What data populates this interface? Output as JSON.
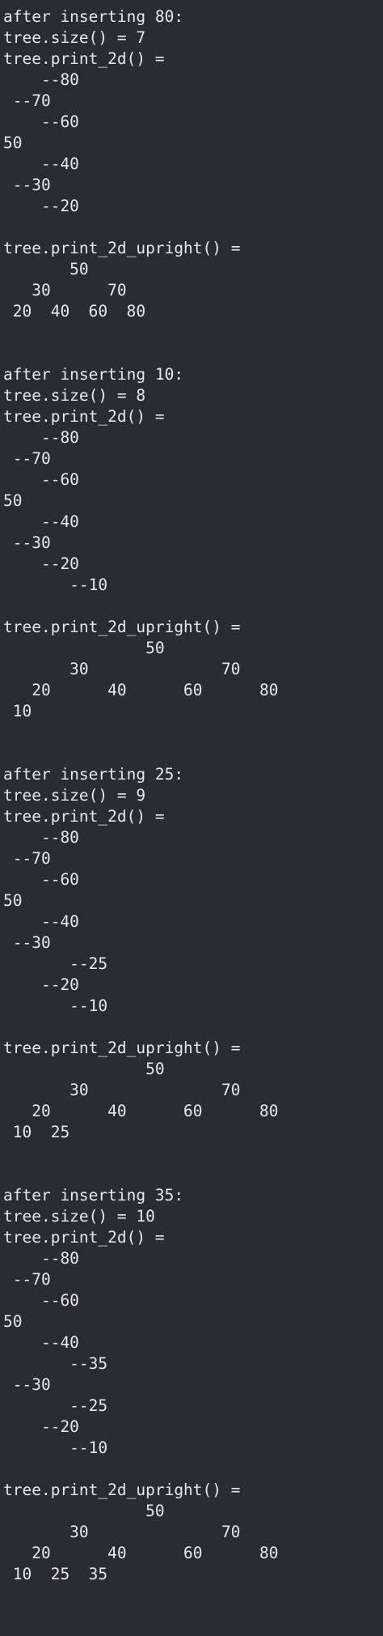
{
  "terminal": {
    "lines": [
      "after inserting 80:",
      "tree.size() = 7",
      "tree.print_2d() =",
      "    --80",
      " --70",
      "    --60",
      "50",
      "    --40",
      " --30",
      "    --20",
      "",
      "tree.print_2d_upright() =",
      "       50",
      "   30      70",
      " 20  40  60  80",
      "",
      "",
      "after inserting 10:",
      "tree.size() = 8",
      "tree.print_2d() =",
      "    --80",
      " --70",
      "    --60",
      "50",
      "    --40",
      " --30",
      "    --20",
      "       --10",
      "",
      "tree.print_2d_upright() =",
      "               50",
      "       30              70",
      "   20      40      60      80",
      " 10",
      "",
      "",
      "after inserting 25:",
      "tree.size() = 9",
      "tree.print_2d() =",
      "    --80",
      " --70",
      "    --60",
      "50",
      "    --40",
      " --30",
      "       --25",
      "    --20",
      "       --10",
      "",
      "tree.print_2d_upright() =",
      "               50",
      "       30              70",
      "   20      40      60      80",
      " 10  25",
      "",
      "",
      "after inserting 35:",
      "tree.size() = 10",
      "tree.print_2d() =",
      "    --80",
      " --70",
      "    --60",
      "50",
      "    --40",
      "       --35",
      " --30",
      "       --25",
      "    --20",
      "       --10",
      "",
      "tree.print_2d_upright() =",
      "               50",
      "       30              70",
      "   20      40      60      80",
      " 10  25  35"
    ]
  }
}
